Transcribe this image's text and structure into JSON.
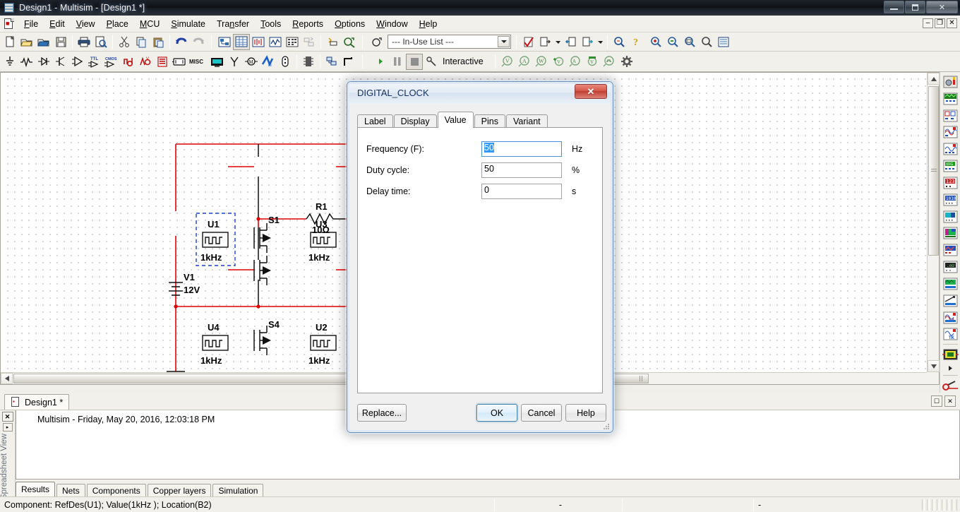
{
  "window": {
    "title": "Design1 - Multisim - [Design1 *]",
    "app_icon": "multisim-icon",
    "minimize": "minimize-button",
    "maximize": "maximize-button",
    "close": "✕"
  },
  "menu": {
    "items": [
      {
        "label": "File",
        "accel": "F"
      },
      {
        "label": "Edit",
        "accel": "E"
      },
      {
        "label": "View",
        "accel": "V"
      },
      {
        "label": "Place",
        "accel": "P"
      },
      {
        "label": "MCU",
        "accel": "M"
      },
      {
        "label": "Simulate",
        "accel": "S"
      },
      {
        "label": "Transfer",
        "accel": "n"
      },
      {
        "label": "Tools",
        "accel": "T"
      },
      {
        "label": "Reports",
        "accel": "R"
      },
      {
        "label": "Options",
        "accel": "O"
      },
      {
        "label": "Window",
        "accel": "W"
      },
      {
        "label": "Help",
        "accel": "H"
      }
    ],
    "mdi_minimize": "–",
    "mdi_restore": "❐",
    "mdi_close": "✕"
  },
  "toolbar_standard": {
    "buttons": [
      "new-icon",
      "open-icon",
      "open-design-icon",
      "save-icon",
      "print-icon",
      "print-preview-icon",
      "cut-icon",
      "copy-icon",
      "paste-icon",
      "undo-icon",
      "redo-icon"
    ]
  },
  "toolbar_view": {
    "buttons": [
      "toggle-design-toolbox-icon",
      "toggle-spreadsheet-icon",
      "sp1-icon",
      "grapher-icon",
      "postprocessor-icon",
      "parent-sheet-icon",
      "create-new-pcb-icon",
      "back-annotate-icon"
    ]
  },
  "toolbar_inuse": {
    "combo_value": "--- In-Use List ---",
    "buttons": [
      "erc-icon",
      "transfer-out-icon",
      "transfer-out-dropdown",
      "back-annotate-in-icon",
      "forward-annotate-icon",
      "forward-dropdown",
      "find-icon",
      "help-icon"
    ]
  },
  "toolbar_zoom": {
    "buttons": [
      "zoom-in-icon",
      "zoom-out-icon",
      "zoom-area-icon",
      "zoom-fit-icon",
      "zoom-full-icon"
    ]
  },
  "toolbar_components": {
    "buttons": [
      "place-source-icon",
      "place-basic-icon",
      "place-diode-icon",
      "place-transistor-icon",
      "place-analog-icon",
      "place-ttl-icon",
      "place-cmos-icon",
      "place-misc-digital-icon",
      "place-mixed-icon",
      "place-indicator-icon",
      "place-power-icon",
      "place-misc-icon",
      "place-advanced-peripherals-icon",
      "place-rf-icon",
      "place-electromechanical-icon",
      "place-nimydaq-icon",
      "place-connectors-icon",
      "place-mcu-icon",
      "place-hierarchical-block-icon",
      "place-bus-icon"
    ]
  },
  "simulation_bar": {
    "run_label": "run-button",
    "pause_label": "pause-button",
    "stop_label": "stop-button",
    "mode_label": "Interactive",
    "instruments": [
      "multimeter-icon",
      "function-generator-icon",
      "wattmeter-icon",
      "oscilloscope-icon",
      "four-channel-osc-icon",
      "bode-plotter-icon",
      "frequency-counter-icon",
      "word-generator-icon"
    ]
  },
  "right_toolbar": {
    "items": [
      "measurement-probe-icon",
      "analog-graph-icon",
      "switch-pair-icon",
      "ac-analysis-icon",
      "dc-analysis-icon",
      "transient-icon",
      "digital-123-icon",
      "logic-converter-icon",
      "logic-analyzer-icon",
      "distortion-analyzer-icon",
      "spectrum-analyzer-icon",
      "network-analyzer-icon",
      "agilent-function-gen-icon",
      "agilent-multimeter-icon",
      "agilent-oscilloscope-icon",
      "tektronix-oscilloscope-icon",
      "labview-instrument-icon",
      "instrument-dropdown-icon",
      "current-probe-icon",
      "more-icon"
    ]
  },
  "design_tab": {
    "label": "Design1 *",
    "icon": "design-file-icon"
  },
  "spreadsheet": {
    "side_label": "Spreadsheet View",
    "close_btn": "✕",
    "pin_btn": "▸",
    "log_line": "Multisim  -  Friday, May 20, 2016, 12:03:18 PM",
    "tabs": [
      {
        "label": "Results",
        "active": true
      },
      {
        "label": "Nets",
        "active": false
      },
      {
        "label": "Components",
        "active": false
      },
      {
        "label": "Copper layers",
        "active": false
      },
      {
        "label": "Simulation",
        "active": false
      }
    ]
  },
  "status_bar": {
    "message": "Component: RefDes(U1); Value(1kHz ); Location(B2)",
    "seg2": "-",
    "seg3": "",
    "seg4": "-"
  },
  "dialog": {
    "title": "DIGITAL_CLOCK",
    "close_label": "✕",
    "tabs": [
      {
        "label": "Label",
        "active": false
      },
      {
        "label": "Display",
        "active": false
      },
      {
        "label": "Value",
        "active": true
      },
      {
        "label": "Pins",
        "active": false
      },
      {
        "label": "Variant",
        "active": false
      }
    ],
    "fields": [
      {
        "label": "Frequency (F):",
        "value": "50",
        "unit": "Hz",
        "focused": true
      },
      {
        "label": "Duty cycle:",
        "value": "50",
        "unit": "%",
        "focused": false
      },
      {
        "label": "Delay time:",
        "value": "0",
        "unit": "s",
        "focused": false
      }
    ],
    "buttons": {
      "replace": "Replace...",
      "ok": "OK",
      "cancel": "Cancel",
      "help": "Help"
    }
  },
  "circuit": {
    "components": [
      {
        "ref": "U1",
        "value": "1kHz",
        "type": "digital-clock",
        "selected": true
      },
      {
        "ref": "S1",
        "value": "",
        "type": "switch"
      },
      {
        "ref": "U3",
        "value": "1kHz",
        "type": "digital-clock"
      },
      {
        "ref": "V1",
        "value": "12V",
        "type": "dc-source"
      },
      {
        "ref": "R1",
        "value": "10Ω",
        "type": "resistor"
      },
      {
        "ref": "U4",
        "value": "1kHz",
        "type": "digital-clock"
      },
      {
        "ref": "S4",
        "value": "",
        "type": "switch"
      },
      {
        "ref": "U2",
        "value": "1kHz",
        "type": "digital-clock"
      }
    ],
    "wire_color": "#e00000",
    "selection_color": "#1a3fd0"
  }
}
